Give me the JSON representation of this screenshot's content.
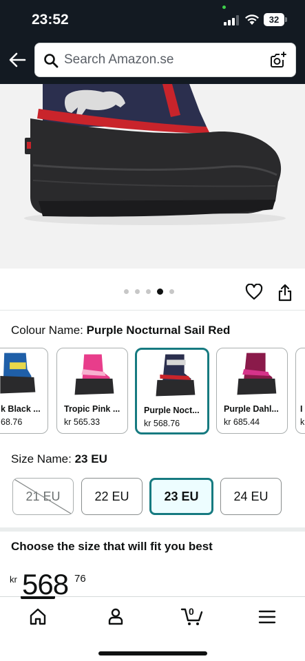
{
  "status_bar": {
    "time": "23:52",
    "battery": "32"
  },
  "search": {
    "placeholder": "Search Amazon.se"
  },
  "gallery": {
    "dot_count": 5,
    "active_dot": 3
  },
  "colour": {
    "label": "Colour Name: ",
    "value": "Purple Nocturnal Sail Red"
  },
  "swatches": [
    {
      "name": "k Black ...",
      "price": "68.76"
    },
    {
      "name": "Tropic Pink ...",
      "price": "kr 565.33"
    },
    {
      "name": "Purple Noct...",
      "price": "kr 568.76"
    },
    {
      "name": "Purple Dahl...",
      "price": "kr 685.44"
    },
    {
      "name": "I",
      "price": "k"
    }
  ],
  "size": {
    "label": "Size Name: ",
    "value": "23 EU",
    "options": [
      "21 EU",
      "22 EU",
      "23 EU",
      "24 EU"
    ]
  },
  "fit_title": "Choose the size that will fit you best",
  "price": {
    "symbol": "kr",
    "whole": "568",
    "fraction": "76"
  },
  "nav": {
    "items": [
      "home",
      "account",
      "cart",
      "menu"
    ],
    "cart_count": "0"
  }
}
